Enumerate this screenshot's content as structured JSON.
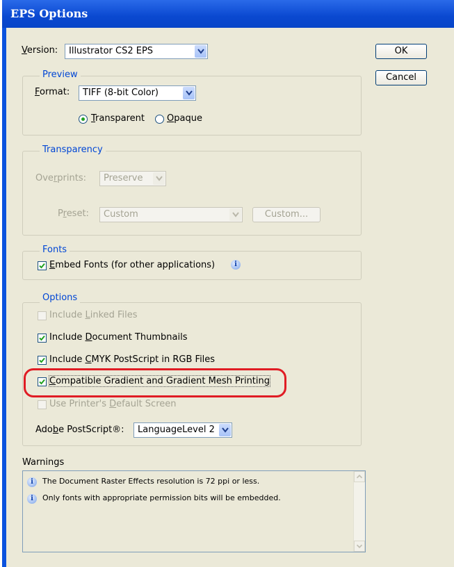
{
  "window": {
    "title": "EPS Options"
  },
  "version": {
    "label_prefix": "",
    "label_u": "V",
    "label_rest": "ersion:",
    "value": "Illustrator CS2 EPS"
  },
  "buttons": {
    "ok": "OK",
    "cancel": "Cancel"
  },
  "preview": {
    "title": "Preview",
    "format_u": "F",
    "format_rest": "ormat:",
    "format_value": "TIFF (8-bit Color)",
    "transparent_u": "T",
    "transparent_rest": "ransparent",
    "opaque_u": "O",
    "opaque_rest": "paque",
    "selected": "Transparent"
  },
  "transparency": {
    "title": "Transparency",
    "overprints_a": "Ove",
    "overprints_u": "r",
    "overprints_b": "prints:",
    "overprints_value": "Preserve",
    "preset_a": "P",
    "preset_u": "r",
    "preset_b": "eset:",
    "preset_value": "Custom",
    "custom_button": "Custom..."
  },
  "fonts": {
    "title": "Fonts",
    "embed_u": "E",
    "embed_rest": "mbed Fonts (for other applications)",
    "embed_checked": true
  },
  "options": {
    "title": "Options",
    "linked_a": "Include ",
    "linked_u": "L",
    "linked_b": "inked Files",
    "linked_checked": false,
    "thumbs_a": "Include ",
    "thumbs_u": "D",
    "thumbs_b": "ocument Thumbnails",
    "thumbs_checked": true,
    "cmyk_a": "Include ",
    "cmyk_u": "C",
    "cmyk_b": "MYK PostScript in RGB Files",
    "cmyk_checked": true,
    "gradient_u": "C",
    "gradient_rest": "ompatible Gradient and Gradient Mesh Printing",
    "gradient_checked": true,
    "printer_a": "Use Printer's ",
    "printer_u": "D",
    "printer_b": "efault Screen",
    "printer_checked": false,
    "ps_a": "Ado",
    "ps_u": "b",
    "ps_b": "e PostScript®:",
    "ps_value": "LanguageLevel 2"
  },
  "warnings": {
    "title": "Warnings",
    "items": [
      "The Document Raster Effects resolution is 72 ppi or less.",
      "Only fonts with appropriate permission bits will be embedded."
    ]
  },
  "colors": {
    "title_bar": "#0845c8",
    "dialog_bg": "#ebe9d8",
    "group_title": "#0046d5",
    "highlight": "#e01c24"
  }
}
